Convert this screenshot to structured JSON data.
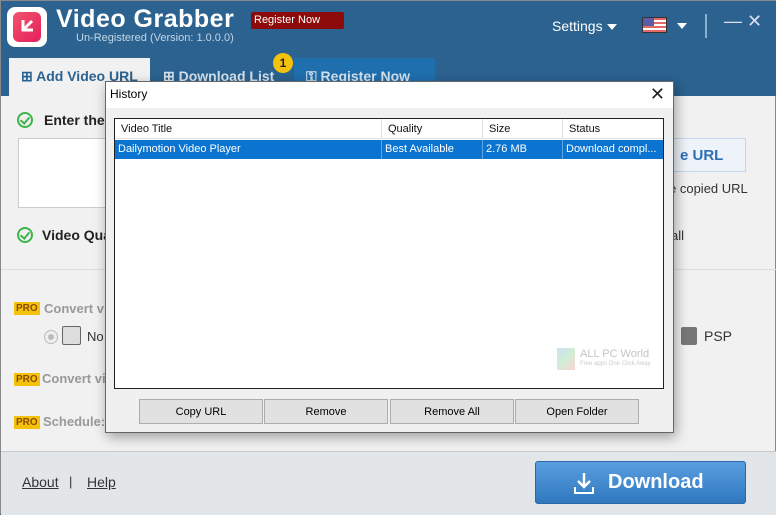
{
  "app": {
    "title": "Video Grabber",
    "subtitle": "Un-Registered (Version: 1.0.0.0)",
    "register_badge": "Register Now",
    "settings_label": "Settings",
    "language_flag": "us-flag-icon",
    "minimize_glyph": "—",
    "close_glyph": "✕"
  },
  "tabs": [
    {
      "label": "Add Video URL",
      "icon": "add-video-icon",
      "active": true
    },
    {
      "label": "Download List",
      "icon": "download-list-icon",
      "badge": "1"
    },
    {
      "label": "Register Now",
      "icon": "key-icon"
    }
  ],
  "main": {
    "step1_label": "Enter the",
    "paste_button": "e URL",
    "copied_url_text": "e copied URL",
    "step2_label": "Video Qua",
    "all_text": "all",
    "pro_badge": "PRO",
    "pro_items": [
      "Convert v",
      "Convert vi",
      "Schedule:"
    ],
    "radio_label": "No",
    "psp_label": "PSP"
  },
  "footer": {
    "about": "About",
    "separator": "|",
    "help": "Help",
    "download_button": "Download"
  },
  "dialog": {
    "title": "History",
    "close_glyph": "✕",
    "columns": [
      "Video Title",
      "Quality",
      "Size",
      "Status"
    ],
    "rows": [
      {
        "title": "Dailymotion Video Player",
        "quality": "Best Available",
        "size": "2.76 MB",
        "status": "Download compl...",
        "selected": true
      }
    ],
    "buttons": [
      "Copy URL",
      "Remove",
      "Remove All",
      "Open Folder"
    ]
  },
  "watermark": {
    "title": "ALL PC World",
    "subtitle": "Free apps One Click Away"
  },
  "colors": {
    "header_bg": "#2b6290",
    "register_badge_bg": "#8c0a0a",
    "selection_blue": "#0a74d0",
    "download_button": "#2f78be",
    "pro_yellow": "#f4c20d",
    "check_green": "#3cb54a"
  }
}
